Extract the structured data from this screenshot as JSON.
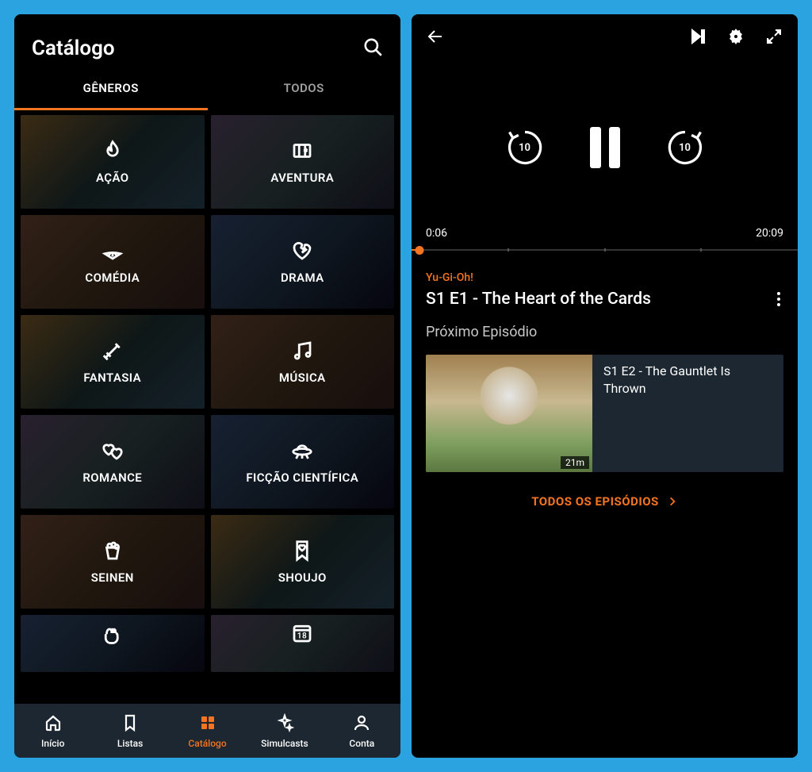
{
  "left": {
    "title": "Catálogo",
    "tabs": {
      "genres": "GÊNEROS",
      "all": "TODOS"
    },
    "genres": [
      {
        "label": "AÇÃO",
        "icon": "fire"
      },
      {
        "label": "AVENTURA",
        "icon": "map"
      },
      {
        "label": "COMÉDIA",
        "icon": "fan"
      },
      {
        "label": "DRAMA",
        "icon": "broken-heart"
      },
      {
        "label": "FANTASIA",
        "icon": "sword"
      },
      {
        "label": "MÚSICA",
        "icon": "music"
      },
      {
        "label": "ROMANCE",
        "icon": "hearts"
      },
      {
        "label": "FICÇÃO CIENTÍFICA",
        "icon": "ufo"
      },
      {
        "label": "SEINEN",
        "icon": "popcorn"
      },
      {
        "label": "SHOUJO",
        "icon": "bookmark-heart"
      }
    ],
    "nav": [
      {
        "label": "Início",
        "icon": "home",
        "active": false
      },
      {
        "label": "Listas",
        "icon": "bookmark",
        "active": false
      },
      {
        "label": "Catálogo",
        "icon": "grid",
        "active": true
      },
      {
        "label": "Simulcasts",
        "icon": "sparkle",
        "active": false
      },
      {
        "label": "Conta",
        "icon": "account",
        "active": false
      }
    ]
  },
  "right": {
    "rewind_seconds": "10",
    "forward_seconds": "10",
    "time_elapsed": "0:06",
    "time_total": "20:09",
    "series": "Yu-Gi-Oh!",
    "episode_title": "S1 E1 - The Heart of the Cards",
    "next_label": "Próximo Episódio",
    "next_episode": {
      "title": "S1 E2 - The Gauntlet Is Thrown",
      "duration": "21m"
    },
    "all_episodes": "TODOS OS EPISÓDIOS"
  }
}
